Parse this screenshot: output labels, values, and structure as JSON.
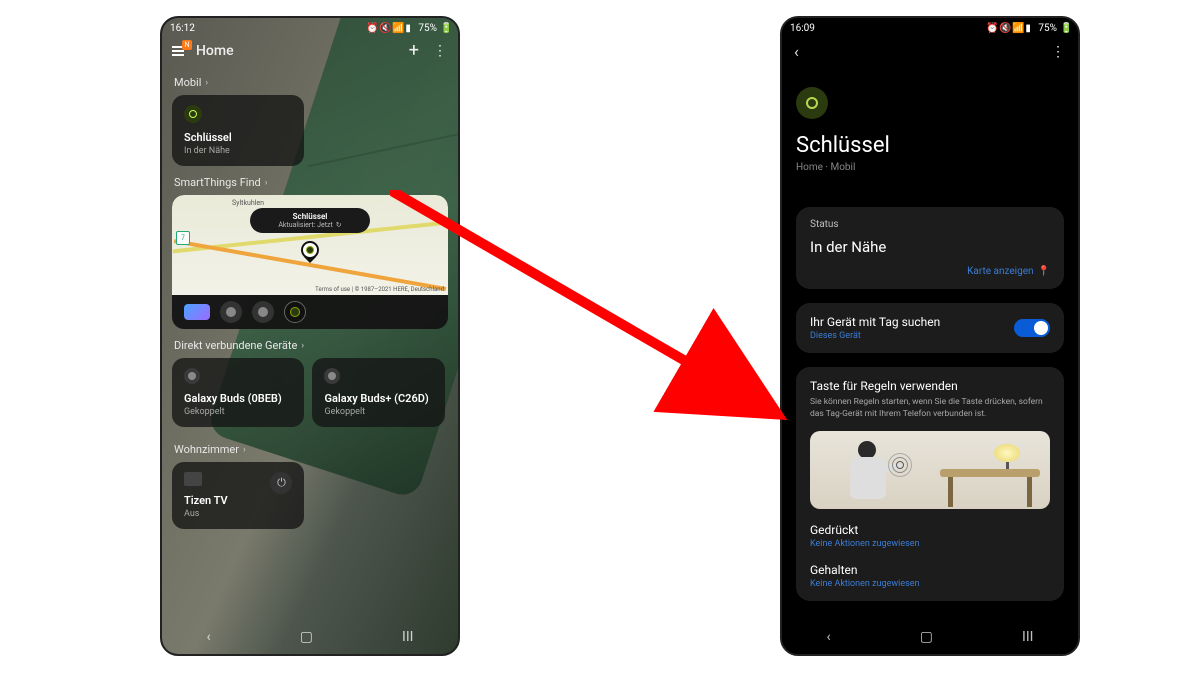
{
  "left": {
    "status": {
      "time": "16:12",
      "battery": "75%"
    },
    "header": {
      "title": "Home",
      "badge": "N"
    },
    "sections": {
      "mobil": {
        "label": "Mobil",
        "card": {
          "title": "Schlüssel",
          "sub": "In der Nähe"
        }
      },
      "find": {
        "label": "SmartThings Find",
        "bubble_title": "Schlüssel",
        "bubble_sub": "Aktualisiert: Jetzt",
        "road_label": "7",
        "town1": "Syltkuhlen",
        "terms": "Terms of use",
        "copy": "| © 1987–2021 HERE, Deutschland"
      },
      "direct": {
        "label": "Direkt verbundene Geräte",
        "dev1": {
          "title": "Galaxy Buds (0BEB)",
          "sub": "Gekoppelt"
        },
        "dev2": {
          "title": "Galaxy Buds+ (C26D)",
          "sub": "Gekoppelt"
        }
      },
      "room": {
        "label": "Wohnzimmer",
        "tv": {
          "title": "Tizen TV",
          "sub": "Aus"
        }
      }
    }
  },
  "right": {
    "status": {
      "time": "16:09",
      "battery": "75%"
    },
    "title": "Schlüssel",
    "crumb": "Home · Mobil",
    "status_card": {
      "label": "Status",
      "value": "In der Nähe",
      "link": "Karte anzeigen"
    },
    "search_card": {
      "title": "Ihr Gerät mit Tag suchen",
      "sub": "Dieses Gerät"
    },
    "rules_card": {
      "title": "Taste für Regeln verwenden",
      "desc": "Sie können Regeln starten, wenn Sie die Taste drücken, sofern das Tag-Gerät mit Ihrem Telefon verbunden ist.",
      "pressed": {
        "title": "Gedrückt",
        "sub": "Keine Aktionen zugewiesen"
      },
      "held": {
        "title": "Gehalten",
        "sub": "Keine Aktionen zugewiesen"
      }
    }
  }
}
